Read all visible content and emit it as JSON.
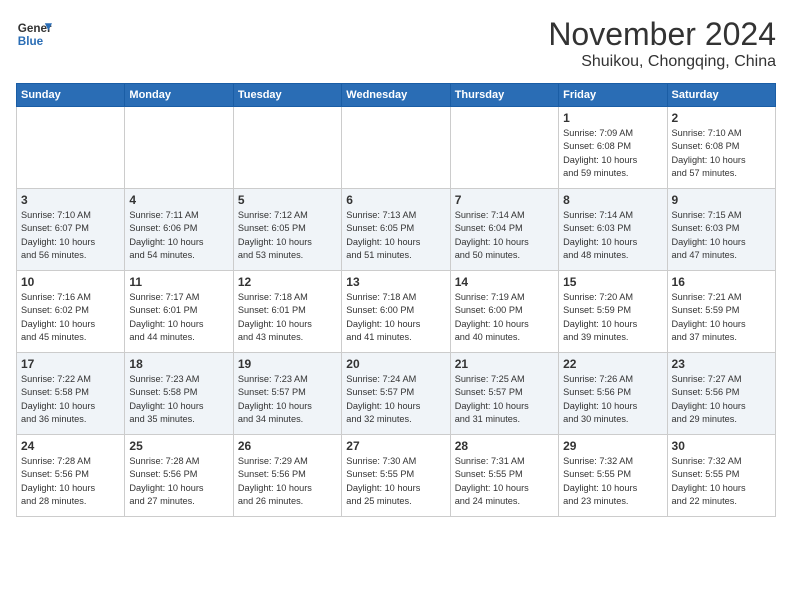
{
  "header": {
    "logo_general": "General",
    "logo_blue": "Blue",
    "title": "November 2024",
    "subtitle": "Shuikou, Chongqing, China"
  },
  "weekdays": [
    "Sunday",
    "Monday",
    "Tuesday",
    "Wednesday",
    "Thursday",
    "Friday",
    "Saturday"
  ],
  "weeks": [
    [
      {
        "day": "",
        "info": ""
      },
      {
        "day": "",
        "info": ""
      },
      {
        "day": "",
        "info": ""
      },
      {
        "day": "",
        "info": ""
      },
      {
        "day": "",
        "info": ""
      },
      {
        "day": "1",
        "info": "Sunrise: 7:09 AM\nSunset: 6:08 PM\nDaylight: 10 hours\nand 59 minutes."
      },
      {
        "day": "2",
        "info": "Sunrise: 7:10 AM\nSunset: 6:08 PM\nDaylight: 10 hours\nand 57 minutes."
      }
    ],
    [
      {
        "day": "3",
        "info": "Sunrise: 7:10 AM\nSunset: 6:07 PM\nDaylight: 10 hours\nand 56 minutes."
      },
      {
        "day": "4",
        "info": "Sunrise: 7:11 AM\nSunset: 6:06 PM\nDaylight: 10 hours\nand 54 minutes."
      },
      {
        "day": "5",
        "info": "Sunrise: 7:12 AM\nSunset: 6:05 PM\nDaylight: 10 hours\nand 53 minutes."
      },
      {
        "day": "6",
        "info": "Sunrise: 7:13 AM\nSunset: 6:05 PM\nDaylight: 10 hours\nand 51 minutes."
      },
      {
        "day": "7",
        "info": "Sunrise: 7:14 AM\nSunset: 6:04 PM\nDaylight: 10 hours\nand 50 minutes."
      },
      {
        "day": "8",
        "info": "Sunrise: 7:14 AM\nSunset: 6:03 PM\nDaylight: 10 hours\nand 48 minutes."
      },
      {
        "day": "9",
        "info": "Sunrise: 7:15 AM\nSunset: 6:03 PM\nDaylight: 10 hours\nand 47 minutes."
      }
    ],
    [
      {
        "day": "10",
        "info": "Sunrise: 7:16 AM\nSunset: 6:02 PM\nDaylight: 10 hours\nand 45 minutes."
      },
      {
        "day": "11",
        "info": "Sunrise: 7:17 AM\nSunset: 6:01 PM\nDaylight: 10 hours\nand 44 minutes."
      },
      {
        "day": "12",
        "info": "Sunrise: 7:18 AM\nSunset: 6:01 PM\nDaylight: 10 hours\nand 43 minutes."
      },
      {
        "day": "13",
        "info": "Sunrise: 7:18 AM\nSunset: 6:00 PM\nDaylight: 10 hours\nand 41 minutes."
      },
      {
        "day": "14",
        "info": "Sunrise: 7:19 AM\nSunset: 6:00 PM\nDaylight: 10 hours\nand 40 minutes."
      },
      {
        "day": "15",
        "info": "Sunrise: 7:20 AM\nSunset: 5:59 PM\nDaylight: 10 hours\nand 39 minutes."
      },
      {
        "day": "16",
        "info": "Sunrise: 7:21 AM\nSunset: 5:59 PM\nDaylight: 10 hours\nand 37 minutes."
      }
    ],
    [
      {
        "day": "17",
        "info": "Sunrise: 7:22 AM\nSunset: 5:58 PM\nDaylight: 10 hours\nand 36 minutes."
      },
      {
        "day": "18",
        "info": "Sunrise: 7:23 AM\nSunset: 5:58 PM\nDaylight: 10 hours\nand 35 minutes."
      },
      {
        "day": "19",
        "info": "Sunrise: 7:23 AM\nSunset: 5:57 PM\nDaylight: 10 hours\nand 34 minutes."
      },
      {
        "day": "20",
        "info": "Sunrise: 7:24 AM\nSunset: 5:57 PM\nDaylight: 10 hours\nand 32 minutes."
      },
      {
        "day": "21",
        "info": "Sunrise: 7:25 AM\nSunset: 5:57 PM\nDaylight: 10 hours\nand 31 minutes."
      },
      {
        "day": "22",
        "info": "Sunrise: 7:26 AM\nSunset: 5:56 PM\nDaylight: 10 hours\nand 30 minutes."
      },
      {
        "day": "23",
        "info": "Sunrise: 7:27 AM\nSunset: 5:56 PM\nDaylight: 10 hours\nand 29 minutes."
      }
    ],
    [
      {
        "day": "24",
        "info": "Sunrise: 7:28 AM\nSunset: 5:56 PM\nDaylight: 10 hours\nand 28 minutes."
      },
      {
        "day": "25",
        "info": "Sunrise: 7:28 AM\nSunset: 5:56 PM\nDaylight: 10 hours\nand 27 minutes."
      },
      {
        "day": "26",
        "info": "Sunrise: 7:29 AM\nSunset: 5:56 PM\nDaylight: 10 hours\nand 26 minutes."
      },
      {
        "day": "27",
        "info": "Sunrise: 7:30 AM\nSunset: 5:55 PM\nDaylight: 10 hours\nand 25 minutes."
      },
      {
        "day": "28",
        "info": "Sunrise: 7:31 AM\nSunset: 5:55 PM\nDaylight: 10 hours\nand 24 minutes."
      },
      {
        "day": "29",
        "info": "Sunrise: 7:32 AM\nSunset: 5:55 PM\nDaylight: 10 hours\nand 23 minutes."
      },
      {
        "day": "30",
        "info": "Sunrise: 7:32 AM\nSunset: 5:55 PM\nDaylight: 10 hours\nand 22 minutes."
      }
    ]
  ]
}
